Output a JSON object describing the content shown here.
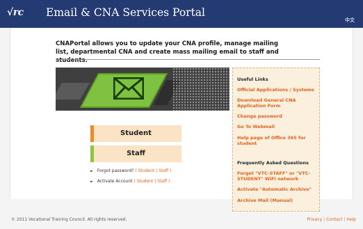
{
  "header": {
    "logo": "√rc",
    "title": "Email & CNA Services Portal",
    "lang": "中文"
  },
  "intro": "CNAPortal allows you to update your CNA profile, manage mailing list, departmental CNA and create mass mailing email to staff and students.",
  "buttons": [
    {
      "label": "Student",
      "stripe": "#f08a28"
    },
    {
      "label": "Staff",
      "stripe": "#8cc63f"
    }
  ],
  "forgot": {
    "text": "Forgot password?",
    "open": "(",
    "student": "Student",
    "sep": "|",
    "staff": "Staff",
    "close": ")"
  },
  "activate": {
    "text": "Activate Account",
    "open": "(",
    "student": "Student",
    "sep": "|",
    "staff": "Staff",
    "close": ")"
  },
  "useful_links": {
    "title": "Useful Links",
    "items": [
      "Official Applications / Systems",
      "Download General CNA Application Form",
      "Change password",
      "Go To Webmail",
      "Help page of Office 365 for student"
    ]
  },
  "faq": {
    "title": "Frequently Asked Questions",
    "items": [
      "Forget \"VTC-STAFF\" or \"VTC-STUDENT\" WiFi network",
      "Activate \"Automatic Archive\"",
      "Archive Mail (Manual)"
    ]
  },
  "footer": {
    "copyright": "© 2011 Vocational Training Council. All rights reserved.",
    "privacy": "Privacy",
    "contact": "Contact",
    "help": "Help",
    "sep": "|"
  },
  "colors": {
    "header": "#243a72",
    "accent": "#e8631c",
    "links_bg": "#fbefde"
  }
}
